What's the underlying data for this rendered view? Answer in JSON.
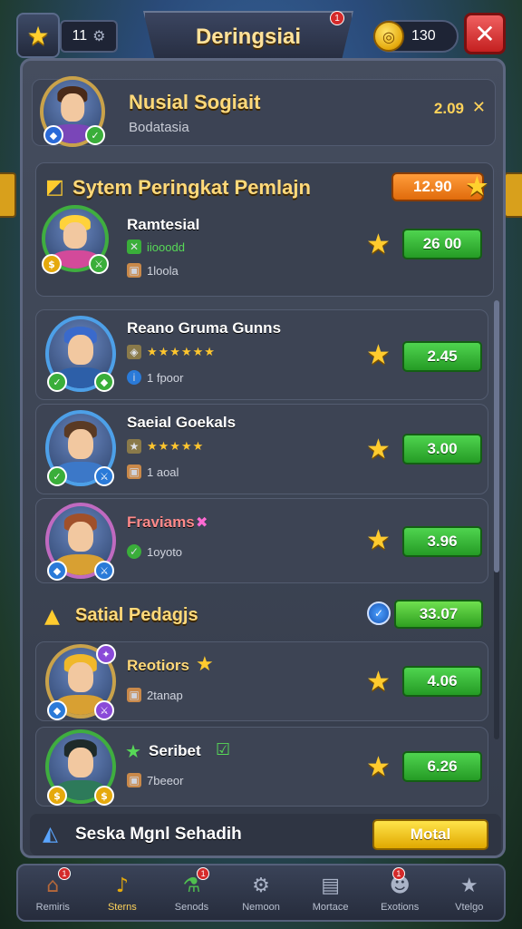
{
  "topbar": {
    "level": "11",
    "title": "Deringsiai",
    "title_badge": "1",
    "coins": "130"
  },
  "profile": {
    "name": "Nusial Sogiait",
    "subtitle": "Bodatasia",
    "value": "2.09"
  },
  "section1": {
    "title": "Sytem Peringkat Pemlajn",
    "pill_value": "12.90"
  },
  "rows": [
    {
      "name": "Ramtesial",
      "line2": "iiooodd",
      "line3": "1loola",
      "value": "26 00",
      "colors": {
        "hair": "#ffd23a",
        "body": "#d34a9a",
        "ring": "#3fae3f"
      }
    },
    {
      "name": "Reano Gruma Gunns",
      "line2": "★★★★★★",
      "line3": "1 fpoor",
      "value": "2.45",
      "colors": {
        "hair": "#3a6acc",
        "body": "#2d5fa8",
        "ring": "#4da0e8"
      }
    },
    {
      "name": "Saeial Goekals",
      "line2": "★★★★★",
      "line3": "1 aoal",
      "value": "3.00",
      "colors": {
        "hair": "#5a3a24",
        "body": "#3c78c8",
        "ring": "#4da0e8"
      }
    },
    {
      "name": "Fraviams",
      "line2": "",
      "line3": "1oyoto",
      "value": "3.96",
      "colors": {
        "hair": "#a0502a",
        "body": "#d8a032",
        "ring": "#c06ac0"
      }
    }
  ],
  "section2": {
    "title": "Satial Pedagjs",
    "value": "33.07"
  },
  "rows2": [
    {
      "name": "Reotiors",
      "line3": "2tanap",
      "value": "4.06",
      "colors": {
        "hair": "#f0b82a",
        "body": "#d8a032",
        "ring": "#c9a24a"
      }
    },
    {
      "name": "Seribet",
      "line3": "7beeor",
      "value": "6.26",
      "colors": {
        "hair": "#1e2a2a",
        "body": "#2d7a5a",
        "ring": "#3fae3f"
      }
    }
  ],
  "footer": {
    "text": "Seska Mgnl Sehadih",
    "button": "Motal"
  },
  "nav": [
    {
      "label": "Remiris",
      "icon": "home-icon",
      "badge": "1"
    },
    {
      "label": "Sterns",
      "icon": "horn-icon",
      "badge": ""
    },
    {
      "label": "Senods",
      "icon": "potion-icon",
      "badge": "1"
    },
    {
      "label": "Nemoon",
      "icon": "gear-icon",
      "badge": ""
    },
    {
      "label": "Mortace",
      "icon": "chest-icon",
      "badge": ""
    },
    {
      "label": "Exotions",
      "icon": "group-icon",
      "badge": "1"
    },
    {
      "label": "Vtelgo",
      "icon": "star-badge-icon",
      "badge": ""
    }
  ],
  "colors": {
    "accent_gold": "#ffd97a",
    "green_button": "#3fc23f",
    "close_red": "#d42a2a",
    "panel": "#3d4454"
  }
}
